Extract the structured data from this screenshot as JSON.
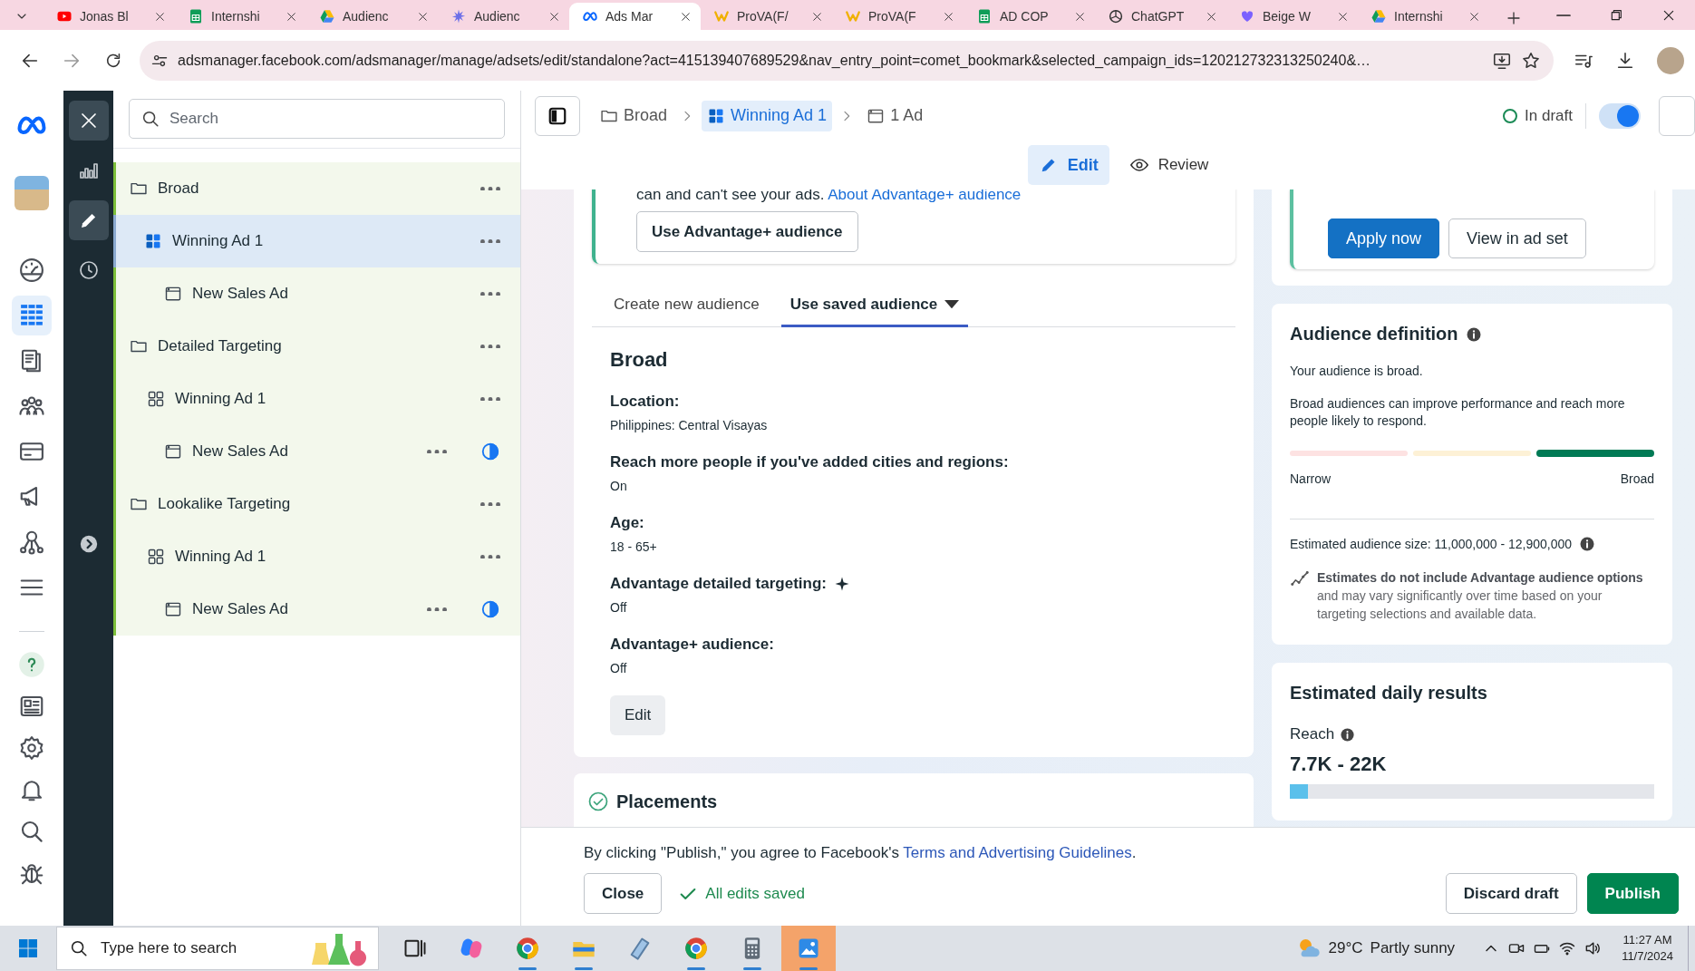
{
  "browser": {
    "tabs": [
      {
        "title": "Jonas Bl",
        "kind": "youtube",
        "selected": false
      },
      {
        "title": "Internshi",
        "kind": "sheets",
        "selected": false
      },
      {
        "title": "Audienc",
        "kind": "drive",
        "selected": false
      },
      {
        "title": "Audienc",
        "kind": "burst",
        "selected": false
      },
      {
        "title": "Ads Mar",
        "kind": "meta",
        "selected": true
      },
      {
        "title": "ProVA(F/",
        "kind": "prova",
        "selected": false
      },
      {
        "title": "ProVA(F",
        "kind": "prova",
        "selected": false
      },
      {
        "title": "AD COP",
        "kind": "sheets",
        "selected": false
      },
      {
        "title": "ChatGPT",
        "kind": "chatgpt",
        "selected": false
      },
      {
        "title": "Beige W",
        "kind": "heart",
        "selected": false
      },
      {
        "title": "Internshi",
        "kind": "drive",
        "selected": false
      }
    ],
    "url": "adsmanager.facebook.com/adsmanager/manage/adsets/edit/standalone?act=415139407689529&nav_entry_point=comet_bookmark&selected_campaign_ids=120212732313250240&…"
  },
  "nav_rail": {
    "items": [
      {
        "kind": "dashboard",
        "selected": false
      },
      {
        "kind": "table",
        "selected": true
      },
      {
        "kind": "catalog",
        "selected": false
      },
      {
        "kind": "people",
        "selected": false
      },
      {
        "kind": "card",
        "selected": false
      },
      {
        "kind": "megaphone",
        "selected": false
      },
      {
        "kind": "network",
        "selected": false
      },
      {
        "kind": "menu",
        "selected": false
      }
    ],
    "bottom_items": [
      {
        "kind": "help",
        "selected": false
      },
      {
        "kind": "news",
        "selected": false
      },
      {
        "kind": "settings",
        "selected": false
      },
      {
        "kind": "bell",
        "selected": false
      },
      {
        "kind": "search",
        "selected": false
      },
      {
        "kind": "bug",
        "selected": false
      }
    ]
  },
  "tool_rail": {
    "items": [
      {
        "kind": "chart",
        "selected": false
      },
      {
        "kind": "edit",
        "selected": true
      },
      {
        "kind": "history",
        "selected": false
      },
      {
        "kind": "expand",
        "selected": false
      }
    ]
  },
  "tree": {
    "search": {
      "placeholder": "Search"
    },
    "items": [
      {
        "label": "Broad",
        "kind": "campaign",
        "selected": false,
        "children": [
          {
            "label": "Winning Ad 1",
            "kind": "adset",
            "selected": true,
            "children": [
              {
                "label": "New Sales Ad",
                "kind": "ad",
                "selected": false,
                "pending": false
              }
            ]
          }
        ]
      },
      {
        "label": "Detailed Targeting",
        "kind": "campaign",
        "selected": false,
        "children": [
          {
            "label": "Winning Ad 1",
            "kind": "adset",
            "selected": false,
            "children": [
              {
                "label": "New Sales Ad",
                "kind": "ad",
                "selected": false,
                "pending": true
              }
            ]
          }
        ]
      },
      {
        "label": "Lookalike Targeting",
        "kind": "campaign",
        "selected": false,
        "children": [
          {
            "label": "Winning Ad 1",
            "kind": "adset",
            "selected": false,
            "children": [
              {
                "label": "New Sales Ad",
                "kind": "ad",
                "selected": false,
                "pending": true
              }
            ]
          }
        ]
      }
    ]
  },
  "header": {
    "breadcrumb": [
      {
        "label": "Broad",
        "kind": "campaign",
        "selected": false
      },
      {
        "label": "Winning Ad 1",
        "kind": "adset",
        "selected": true
      },
      {
        "label": "1 Ad",
        "kind": "ad",
        "selected": false
      }
    ],
    "status": "In draft",
    "toggle_on": true,
    "modes": [
      {
        "label": "Edit",
        "kind": "edit",
        "selected": true
      },
      {
        "label": "Review",
        "kind": "review",
        "selected": false
      }
    ]
  },
  "audience": {
    "notice": {
      "text": "can and can't see your ads.",
      "link": "About Advantage+ audience",
      "button": "Use Advantage+ audience"
    },
    "tabs": [
      {
        "label": "Create new audience",
        "selected": false,
        "dropdown": false
      },
      {
        "label": "Use saved audience",
        "selected": true,
        "dropdown": true
      }
    ],
    "saved": {
      "name": "Broad",
      "fields": [
        {
          "label": "Location:",
          "value": "Philippines: Central Visayas",
          "sparkle": false
        },
        {
          "label": "Reach more people if you've added cities and regions:",
          "value": "On",
          "sparkle": false
        },
        {
          "label": "Age:",
          "value": "18 - 65+",
          "sparkle": false
        },
        {
          "label": "Advantage detailed targeting:",
          "value": "Off",
          "sparkle": true
        },
        {
          "label": "Advantage+ audience:",
          "value": "Off",
          "sparkle": false
        }
      ],
      "edit_button": "Edit"
    },
    "placements": {
      "title": "Placements",
      "complete": true
    }
  },
  "suggestion": {
    "buttons": [
      {
        "label": "Apply now",
        "kind": "primary"
      },
      {
        "label": "View in ad set",
        "kind": "secondary"
      }
    ]
  },
  "definition": {
    "title": "Audience definition",
    "summary": "Your audience is broad.",
    "description": "Broad audiences can improve performance and reach more people likely to respond.",
    "segments": [
      {
        "color": "#fde2e2",
        "selected": false
      },
      {
        "color": "#fdf1d6",
        "selected": false
      },
      {
        "color": "#007a55",
        "selected": true
      }
    ],
    "low_label": "Narrow",
    "high_label": "Broad",
    "size": "Estimated audience size: 11,000,000 - 12,900,000",
    "note": "**Estimates do not include Advantage audience options** and may vary significantly over time based on your targeting selections and available data."
  },
  "results": {
    "title": "Estimated daily results",
    "metric": "Reach",
    "range": "7.7K - 22K",
    "level": 0.05
  },
  "footer": {
    "consent": {
      "text": "By clicking \"Publish,\" you agree to Facebook's",
      "link": "Terms and Advertising Guidelines",
      "end": "."
    },
    "close": "Close",
    "saved": "All edits saved",
    "discard": "Discard draft",
    "publish": "Publish"
  },
  "taskbar": {
    "search": {
      "placeholder": "Type here to search"
    },
    "apps": [
      {
        "kind": "taskview",
        "running": false,
        "selected": false
      },
      {
        "kind": "copilot",
        "running": false,
        "selected": false
      },
      {
        "kind": "chrome",
        "running": true,
        "selected": false
      },
      {
        "kind": "files",
        "running": true,
        "selected": false
      },
      {
        "kind": "notes",
        "running": false,
        "selected": false
      },
      {
        "kind": "chrome",
        "running": true,
        "selected": false
      },
      {
        "kind": "calculator",
        "running": true,
        "selected": false
      },
      {
        "kind": "photos",
        "running": true,
        "selected": true
      }
    ],
    "weather": {
      "temp": "29°C",
      "condition": "Partly sunny"
    },
    "time": "11:27 AM",
    "date": "11/7/2024"
  }
}
